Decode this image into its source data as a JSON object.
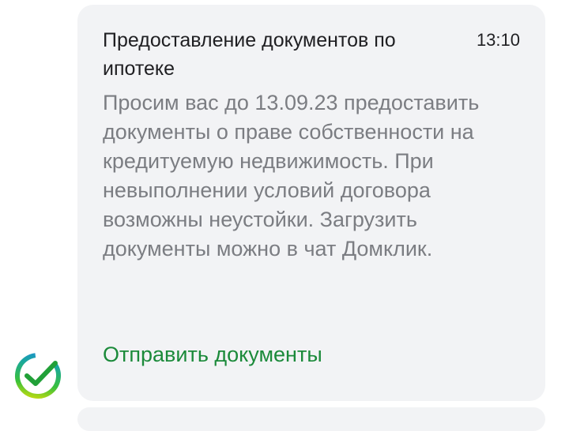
{
  "notification": {
    "title": "Предоставление документов по ипотеке",
    "time": "13:10",
    "body": "Просим вас до 13.09.23 предоставить документы о праве собственности на кредитуемую недвижимость. При невыполнении условий договора возможны неустойки. Загрузить документы можно в чат Домклик.",
    "action_label": "Отправить документы"
  },
  "sender": {
    "icon": "sber-logo-icon"
  },
  "colors": {
    "bubble_bg": "#f2f3f5",
    "title_text": "#1f1f22",
    "body_text": "#7b7d82",
    "action_text": "#1b8a3a"
  }
}
